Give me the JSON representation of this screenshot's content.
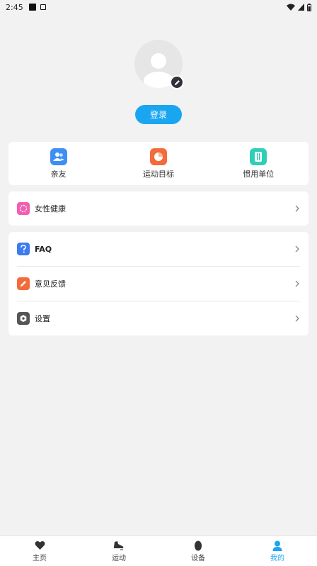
{
  "statusbar": {
    "time": "2:45"
  },
  "profile": {
    "login_label": "登录"
  },
  "quick_actions": [
    {
      "label": "亲友",
      "color": "#3d8ef5"
    },
    {
      "label": "运动目标",
      "color": "#f36b3a"
    },
    {
      "label": "惯用单位",
      "color": "#2ecfb8"
    }
  ],
  "menu_women": {
    "label": "女性健康",
    "color": "#f05fb0"
  },
  "menu_list": [
    {
      "label": "FAQ",
      "color": "#3d7cf0"
    },
    {
      "label": "意见反馈",
      "color": "#f36b3a"
    },
    {
      "label": "设置",
      "color": "#555555"
    }
  ],
  "tabs": [
    {
      "label": "主页"
    },
    {
      "label": "运动"
    },
    {
      "label": "设备"
    },
    {
      "label": "我的",
      "active": true
    }
  ],
  "colors": {
    "accent": "#1aa5f0"
  }
}
